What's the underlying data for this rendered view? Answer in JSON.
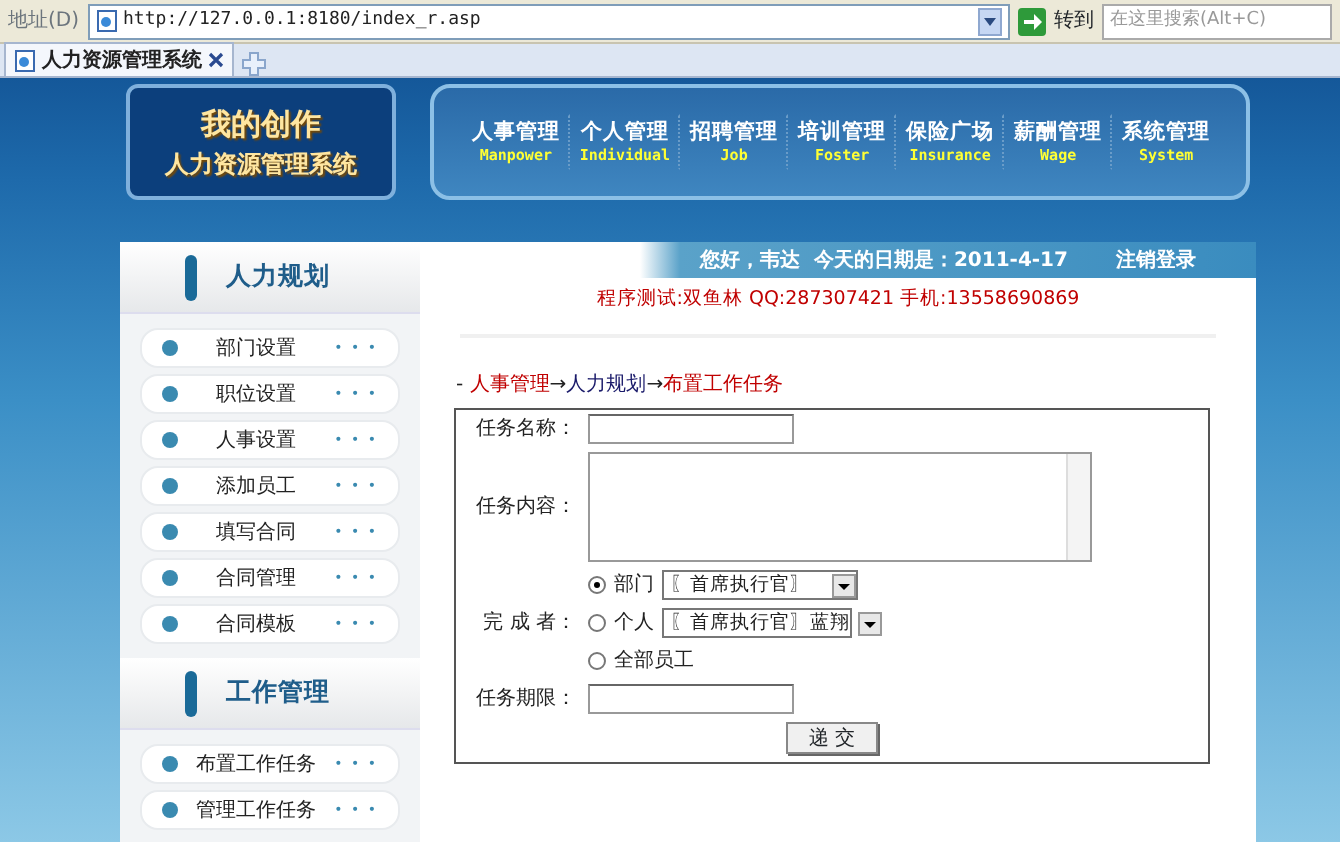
{
  "browser": {
    "address_label": "地址(D)",
    "url": "http://127.0.0.1:8180/index_r.asp",
    "go_label": "转到",
    "search_placeholder": "在这里搜索(Alt+C)",
    "tabs": [
      {
        "title": "人力资源管理系统",
        "selected": true
      }
    ]
  },
  "logo": {
    "line1": "我的创作",
    "line2": "人力资源管理系统"
  },
  "nav": [
    {
      "label": "人事管理",
      "sub": "Manpower"
    },
    {
      "label": "个人管理",
      "sub": "Individual"
    },
    {
      "label": "招聘管理",
      "sub": "Job"
    },
    {
      "label": "培训管理",
      "sub": "Foster"
    },
    {
      "label": "保险广场",
      "sub": "Insurance"
    },
    {
      "label": "薪酬管理",
      "sub": "Wage"
    },
    {
      "label": "系统管理",
      "sub": "System"
    }
  ],
  "sidebar": [
    {
      "title": "人力规划",
      "items": [
        {
          "label": "部门设置",
          "more": "• • •"
        },
        {
          "label": "职位设置",
          "more": "• • •"
        },
        {
          "label": "人事设置",
          "more": "• • •"
        },
        {
          "label": "添加员工",
          "more": "• • •"
        },
        {
          "label": "填写合同",
          "more": "• • •"
        },
        {
          "label": "合同管理",
          "more": "• • •"
        },
        {
          "label": "合同模板",
          "more": "• • •"
        }
      ]
    },
    {
      "title": "工作管理",
      "items": [
        {
          "label": "布置工作任务",
          "more": "• • •"
        },
        {
          "label": "管理工作任务",
          "more": "• • •"
        }
      ]
    }
  ],
  "greeting": "您好，韦达  今天的日期是：2011-4-17",
  "logout": "注销登录",
  "tester": "程序测试:双鱼林 QQ:287307421 手机:13558690869",
  "breadcrumb": {
    "prefix": "-",
    "separator": "→",
    "items": [
      {
        "label": "人事管理",
        "color": "#c00000"
      },
      {
        "label": "人力规划",
        "color": "#1a1a6a"
      },
      {
        "label": "布置工作任务",
        "color": "#c00000"
      }
    ]
  },
  "form": {
    "name_label": "任务名称：",
    "content_label": "任务内容：",
    "assignee_label": "完 成 者：",
    "assignee_options": [
      {
        "label": "部门",
        "selected": true,
        "select_value": "〖首席执行官〗"
      },
      {
        "label": "个人",
        "selected": false,
        "select_value": "〖首席执行官〗蓝翔"
      },
      {
        "label": "全部员工",
        "selected": false
      }
    ],
    "deadline_label": "任务期限：",
    "submit": "递 交"
  }
}
